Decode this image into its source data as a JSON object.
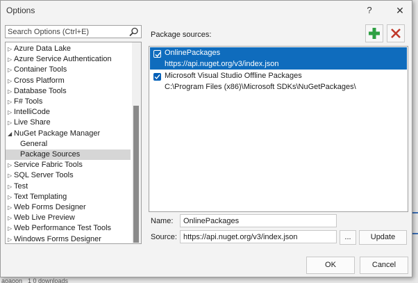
{
  "window": {
    "title": "Options",
    "help_glyph": "?",
    "close_glyph": "✕"
  },
  "search": {
    "placeholder": "Search Options (Ctrl+E)"
  },
  "tree": {
    "items": [
      {
        "label": "Azure Data Lake",
        "expanded": false
      },
      {
        "label": "Azure Service Authentication",
        "expanded": false
      },
      {
        "label": "Container Tools",
        "expanded": false
      },
      {
        "label": "Cross Platform",
        "expanded": false
      },
      {
        "label": "Database Tools",
        "expanded": false
      },
      {
        "label": "F# Tools",
        "expanded": false
      },
      {
        "label": "IntelliCode",
        "expanded": false
      },
      {
        "label": "Live Share",
        "expanded": false
      },
      {
        "label": "NuGet Package Manager",
        "expanded": true
      },
      {
        "label": "General",
        "child": true
      },
      {
        "label": "Package Sources",
        "child": true,
        "selected": true
      },
      {
        "label": "Service Fabric Tools",
        "expanded": false
      },
      {
        "label": "SQL Server Tools",
        "expanded": false
      },
      {
        "label": "Test",
        "expanded": false
      },
      {
        "label": "Text Templating",
        "expanded": false
      },
      {
        "label": "Web Forms Designer",
        "expanded": false
      },
      {
        "label": "Web Live Preview",
        "expanded": false
      },
      {
        "label": "Web Performance Test Tools",
        "expanded": false
      },
      {
        "label": "Windows Forms Designer",
        "expanded": false
      }
    ]
  },
  "package_sources": {
    "label": "Package sources:",
    "sources": [
      {
        "name": "OnlinePackages",
        "url": "https://api.nuget.org/v3/index.json",
        "checked": true,
        "selected": true
      },
      {
        "name": "Microsoft Visual Studio Offline Packages",
        "url": "C:\\Program Files (x86)\\Microsoft SDKs\\NuGetPackages\\",
        "checked": true,
        "selected": false
      }
    ]
  },
  "form": {
    "name_label": "Name:",
    "name_value": "OnlinePackages",
    "source_label": "Source:",
    "source_value": "https://api.nuget.org/v3/index.json",
    "browse_label": "...",
    "update_label": "Update"
  },
  "buttons": {
    "ok": "OK",
    "cancel": "Cancel"
  },
  "background": {
    "fragment_1": "aoaoon",
    "fragment_2": "1 0 downloads"
  },
  "colors": {
    "accent": "#0f6cbd",
    "add": "#2ea043",
    "remove": "#c0392b"
  },
  "icons": {
    "add": "plus-icon",
    "remove": "x-icon",
    "search": "search-icon",
    "expand": "triangle-right-icon",
    "collapse": "triangle-down-icon"
  }
}
